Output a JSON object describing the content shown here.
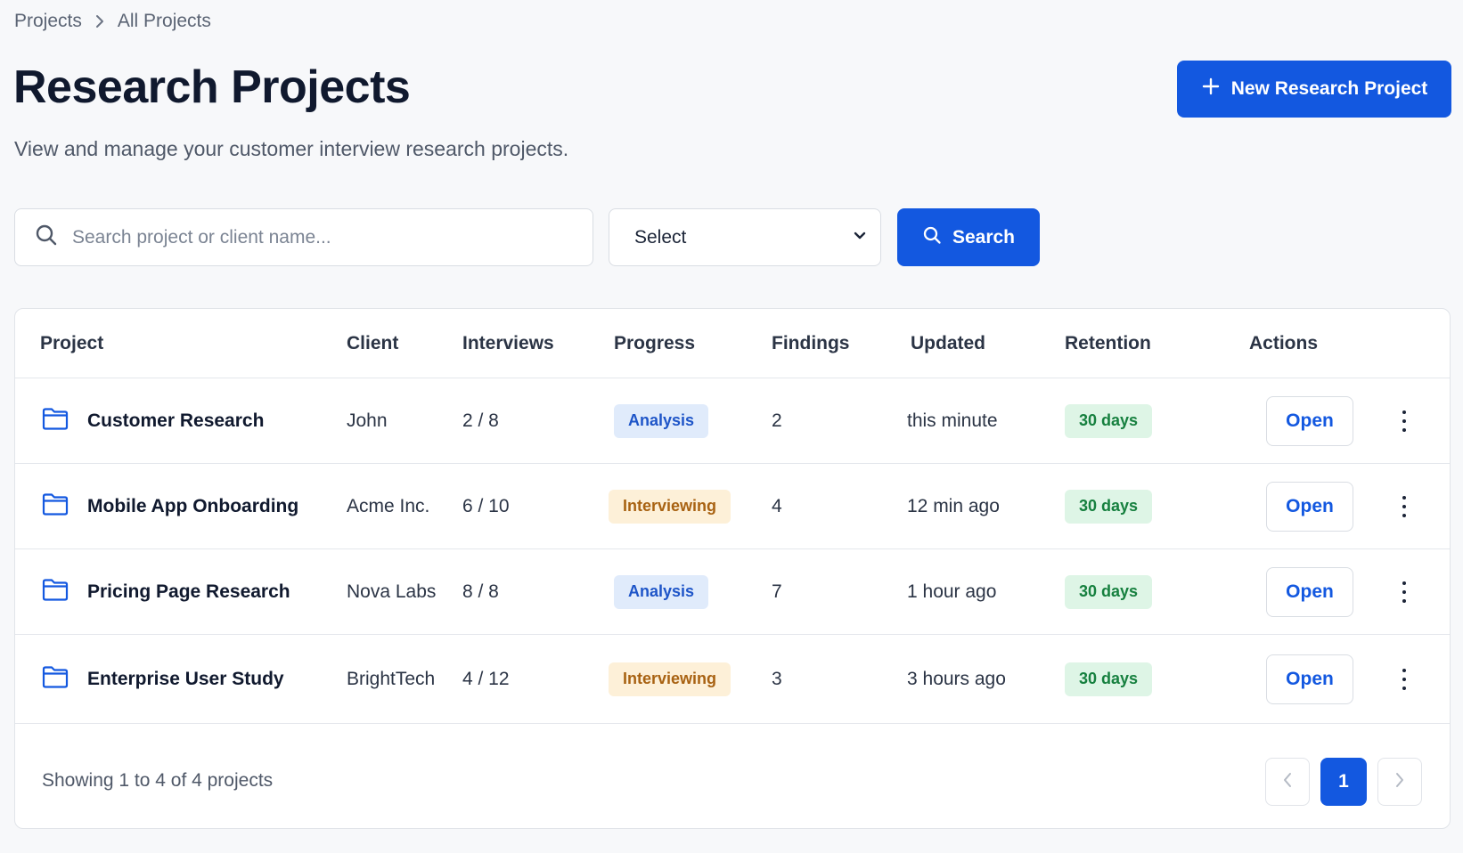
{
  "breadcrumb": {
    "items": [
      "Projects",
      "All Projects"
    ]
  },
  "header": {
    "title": "Research Projects",
    "subtitle": "View and manage your customer interview research projects.",
    "new_button_label": "New Research Project"
  },
  "filters": {
    "search_placeholder": "Search project or client name...",
    "search_value": "",
    "select_value": "Select",
    "search_button_label": "Search"
  },
  "table": {
    "columns": [
      "Project",
      "Client",
      "Interviews",
      "Progress",
      "Findings",
      "Updated",
      "Retention",
      "Actions"
    ],
    "rows": [
      {
        "project": "Customer Research",
        "client": "John",
        "interviews": "2 / 8",
        "progress": "Analysis",
        "findings": "2",
        "updated": "this minute",
        "retention": "30 days",
        "action": "Open"
      },
      {
        "project": "Mobile App Onboarding",
        "client": "Acme Inc.",
        "interviews": "6 / 10",
        "progress": "Interviewing",
        "findings": "4",
        "updated": "12 min ago",
        "retention": "30 days",
        "action": "Open"
      },
      {
        "project": "Pricing Page Research",
        "client": "Nova Labs",
        "interviews": "8 / 8",
        "progress": "Analysis",
        "findings": "7",
        "updated": "1 hour ago",
        "retention": "30 days",
        "action": "Open"
      },
      {
        "project": "Enterprise User Study",
        "client": "BrightTech",
        "interviews": "4 / 12",
        "progress": "Interviewing",
        "findings": "3",
        "updated": "3 hours ago",
        "retention": "30 days",
        "action": "Open"
      }
    ]
  },
  "pagination": {
    "summary": "Showing 1 to 4 of 4 projects",
    "current_page": "1"
  },
  "colors": {
    "primary": "#1358e0",
    "analysis_bg": "#e0ebfb",
    "interviewing_bg": "#fdf0d8",
    "retention_bg": "#def5e6"
  },
  "icons": {
    "breadcrumb_separator": "chevron-right-icon",
    "new_button": "plus-icon",
    "search": "search-icon",
    "select": "chevron-down-icon",
    "project": "folder-icon",
    "row_menu": "more-vertical-icon",
    "prev_page": "chevron-left-icon",
    "next_page": "chevron-right-icon"
  }
}
